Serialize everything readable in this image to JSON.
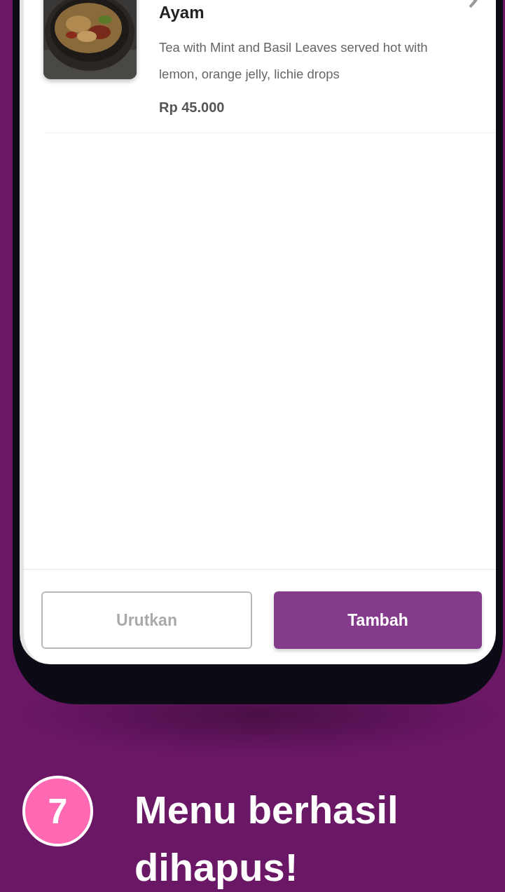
{
  "menu_item": {
    "name": "Ayam",
    "description": "Tea with Mint and Basil Leaves served hot with lemon, orange jelly, lichie drops",
    "price": "Rp 45.000"
  },
  "buttons": [
    {
      "label": "Urutkan",
      "kind": "outline"
    },
    {
      "label": "Tambah",
      "kind": "primary"
    }
  ],
  "step": {
    "number": "7",
    "title": "Menu berhasil dihapus!"
  }
}
